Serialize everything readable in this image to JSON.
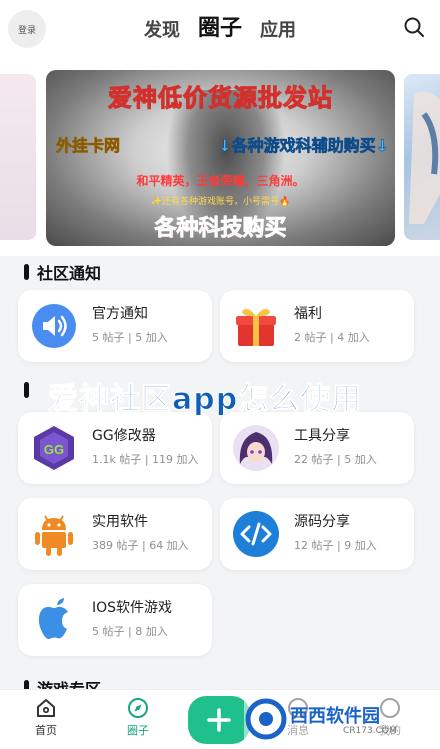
{
  "header": {
    "login_label": "登录",
    "tabs": [
      {
        "label": "发现",
        "active": false
      },
      {
        "label": "圈子",
        "active": true
      },
      {
        "label": "应用",
        "active": false
      }
    ]
  },
  "banner": {
    "title": "爱神低价货源批发站",
    "shop": "外挂卡网",
    "buy": "↓各种游戏科辅助购买↓",
    "games": "和平精英，王者荣耀，三角洲。",
    "note": "✨还有各种游戏账号，小号需号🔥",
    "cta": "各种科技购买"
  },
  "sections": {
    "community_notice": "社区通知",
    "game_zone": "游戏专区"
  },
  "notice_cards": [
    {
      "name": "官方通知",
      "stats": "5 帖子 | 5 加入",
      "icon": "speaker-icon"
    },
    {
      "name": "福利",
      "stats": "2 帖子 | 4 加入",
      "icon": "gift-icon"
    }
  ],
  "tool_cards": [
    {
      "name": "GG修改器",
      "stats": "1.1k 帖子 | 119 加入",
      "icon": "gg-modifier-icon"
    },
    {
      "name": "工具分享",
      "stats": "22 帖子 | 5 加入",
      "icon": "anime-avatar-icon"
    },
    {
      "name": "实用软件",
      "stats": "389 帖子 | 64 加入",
      "icon": "android-icon"
    },
    {
      "name": "源码分享",
      "stats": "12 帖子 | 9 加入",
      "icon": "code-icon"
    },
    {
      "name": "IOS软件游戏",
      "stats": "5 帖子 | 8 加入",
      "icon": "apple-icon"
    }
  ],
  "overlay_caption": "爱神社区app怎么使用",
  "bottom_nav": [
    {
      "label": "首页",
      "icon": "home-icon",
      "active": false
    },
    {
      "label": "圈子",
      "icon": "compass-icon",
      "active": true
    },
    {
      "label": "消息",
      "icon": "message-icon",
      "active": false
    },
    {
      "label": "我的",
      "icon": "profile-icon",
      "active": false
    }
  ],
  "watermark": {
    "text": "西西软件园",
    "sub": "CR173.COM"
  },
  "colors": {
    "accent": "#1fc08b",
    "overlay": "#1060b8"
  }
}
